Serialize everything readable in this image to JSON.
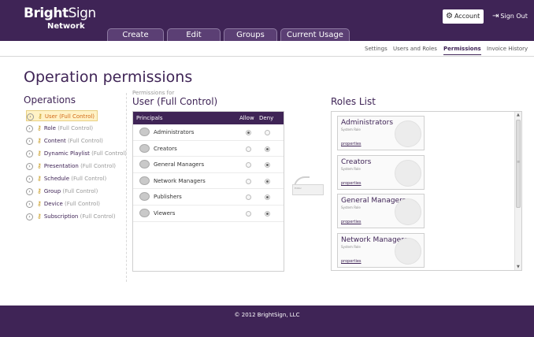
{
  "brand": {
    "name_bold": "Bright",
    "name_light": "Sign",
    "sub": "Network"
  },
  "tabs": [
    "Create",
    "Edit",
    "Groups",
    "Current Usage"
  ],
  "account_label": "Account",
  "signout_label": "Sign Out",
  "subnav": [
    "Settings",
    "Users and Roles",
    "Permissions",
    "Invoice History"
  ],
  "page_title": "Operation permissions",
  "operations": {
    "title": "Operations",
    "items": [
      {
        "name": "User",
        "ctl": "(Full Control)"
      },
      {
        "name": "Role",
        "ctl": "(Full Control)"
      },
      {
        "name": "Content",
        "ctl": "(Full Control)"
      },
      {
        "name": "Dynamic Playlist",
        "ctl": "(Full Control)"
      },
      {
        "name": "Presentation",
        "ctl": "(Full Control)"
      },
      {
        "name": "Schedule",
        "ctl": "(Full Control)"
      },
      {
        "name": "Group",
        "ctl": "(Full Control)"
      },
      {
        "name": "Device",
        "ctl": "(Full Control)"
      },
      {
        "name": "Subscription",
        "ctl": "(Full Control)"
      }
    ]
  },
  "permissions_for": {
    "label": "Permissions for",
    "title": "User (Full Control)",
    "headers": {
      "principals": "Principals",
      "allow": "Allow",
      "deny": "Deny"
    },
    "rows": [
      {
        "name": "Administrators",
        "value": "allow"
      },
      {
        "name": "Creators",
        "value": "deny"
      },
      {
        "name": "General Managers",
        "value": "deny"
      },
      {
        "name": "Network Managers",
        "value": "deny"
      },
      {
        "name": "Publishers",
        "value": "deny"
      },
      {
        "name": "Viewers",
        "value": "deny"
      }
    ]
  },
  "drag_hint": {
    "card_text": "Editor"
  },
  "roles": {
    "title": "Roles List",
    "items": [
      {
        "name": "Administrators",
        "sub": "System Role",
        "link": "properties"
      },
      {
        "name": "Creators",
        "sub": "System Role",
        "link": "properties"
      },
      {
        "name": "General Managers",
        "sub": "System Role",
        "link": "properties"
      },
      {
        "name": "Network Managers",
        "sub": "System Role",
        "link": "properties"
      }
    ]
  },
  "footer": "© 2012 BrightSign, LLC",
  "colors": {
    "brand_purple": "#3f2456",
    "selected_bg": "#fff2c6",
    "selected_text": "#d26a18"
  }
}
